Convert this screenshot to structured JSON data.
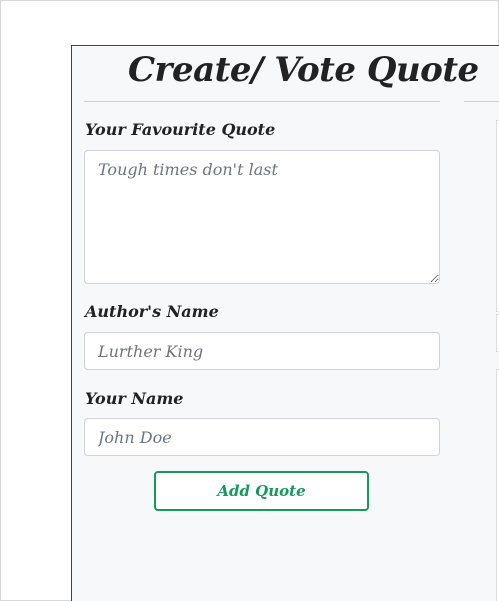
{
  "form": {
    "title": "Create/ Vote Quote",
    "quote_label": "Your Favourite Quote",
    "quote_placeholder": "Tough times don't last",
    "author_label": "Author's Name",
    "author_placeholder": "Lurther King",
    "name_label": "Your Name",
    "name_placeholder": "John Doe",
    "submit_label": "Add Quote"
  },
  "colors": {
    "panel_border": "#8f1f3c",
    "submit_button": "#159a5b"
  }
}
